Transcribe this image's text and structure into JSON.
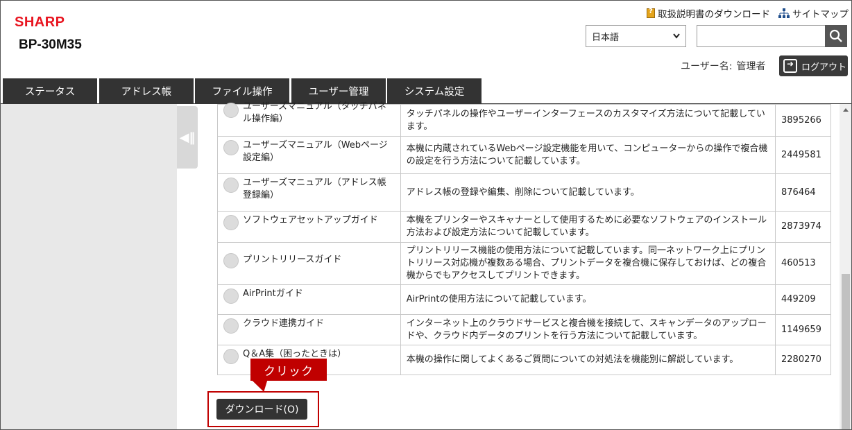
{
  "header": {
    "brand": "SHARP",
    "model": "BP-30M35",
    "links": {
      "manual_download": "取扱説明書のダウンロード",
      "sitemap": "サイトマップ"
    },
    "language": "日本語",
    "search_placeholder": "",
    "user_label": "ユーザー名:",
    "user_name": "管理者",
    "logout_label": "ログアウト"
  },
  "tabs": [
    "ステータス",
    "アドレス帳",
    "ファイル操作",
    "ユーザー管理",
    "システム設定"
  ],
  "manuals": [
    {
      "name": "ユーザーズマニュアル（タッチパネル操作編）",
      "description": "タッチパネルの操作やユーザーインターフェースのカスタマイズ方法について記載しています。",
      "size": "3895266"
    },
    {
      "name": "ユーザーズマニュアル（Webページ設定編）",
      "description": "本機に内蔵されているWebページ設定機能を用いて、コンピューターからの操作で複合機の設定を行う方法について記載しています。",
      "size": "2449581"
    },
    {
      "name": "ユーザーズマニュアル（アドレス帳登録編）",
      "description": "アドレス帳の登録や編集、削除について記載しています。",
      "size": "876464"
    },
    {
      "name": "ソフトウェアセットアップガイド",
      "description": "本機をプリンターやスキャナーとして使用するために必要なソフトウェアのインストール方法および設定方法について記載しています。",
      "size": "2873974"
    },
    {
      "name": "プリントリリースガイド",
      "description": "プリントリリース機能の使用方法について記載しています。同一ネットワーク上にプリントリリース対応機が複数ある場合、プリントデータを複合機に保存しておけば、どの複合機からでもアクセスしてプリントできます。",
      "size": "460513"
    },
    {
      "name": "AirPrintガイド",
      "description": "AirPrintの使用方法について記載しています。",
      "size": "449209"
    },
    {
      "name": "クラウド連携ガイド",
      "description": "インターネット上のクラウドサービスと複合機を接続して、スキャンデータのアップロードや、クラウド内データのプリントを行う方法について記載しています。",
      "size": "1149659"
    },
    {
      "name": "Q＆A集（困ったときは）",
      "description": "本機の操作に関してよくあるご質問についての対処法を機能別に解説しています。",
      "size": "2280270"
    }
  ],
  "callout": "クリック",
  "download_button": "ダウンロード(O)",
  "colors": {
    "brand": "#e8141f",
    "callout": "#c00000",
    "tab": "#333333"
  }
}
